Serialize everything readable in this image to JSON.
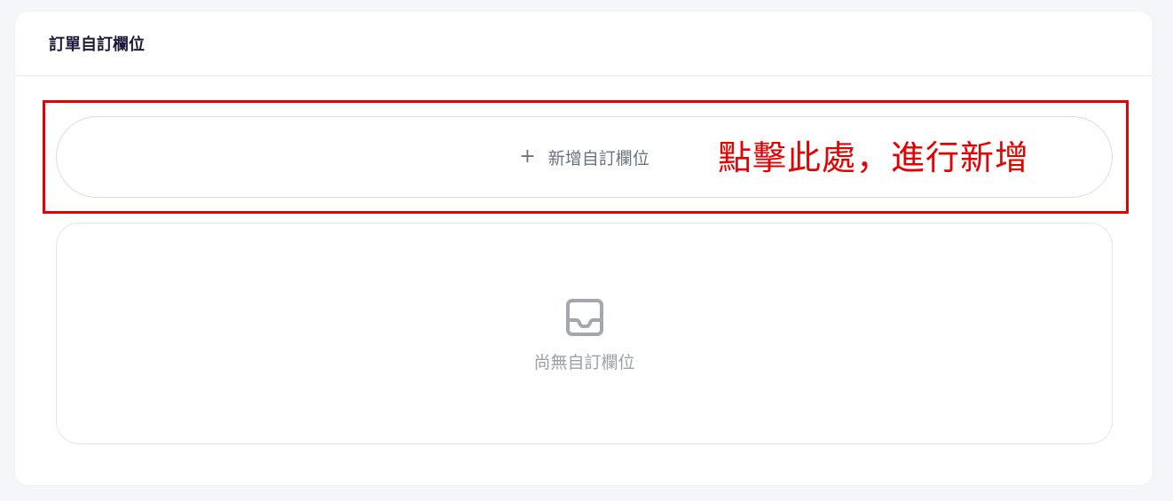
{
  "card": {
    "title": "訂單自訂欄位"
  },
  "add_field": {
    "plus": "+",
    "label": "新增自訂欄位"
  },
  "annotation": {
    "text": "點擊此處，進行新增",
    "color": "#e60000"
  },
  "empty_state": {
    "icon": "inbox-icon",
    "text": "尚無自訂欄位"
  }
}
